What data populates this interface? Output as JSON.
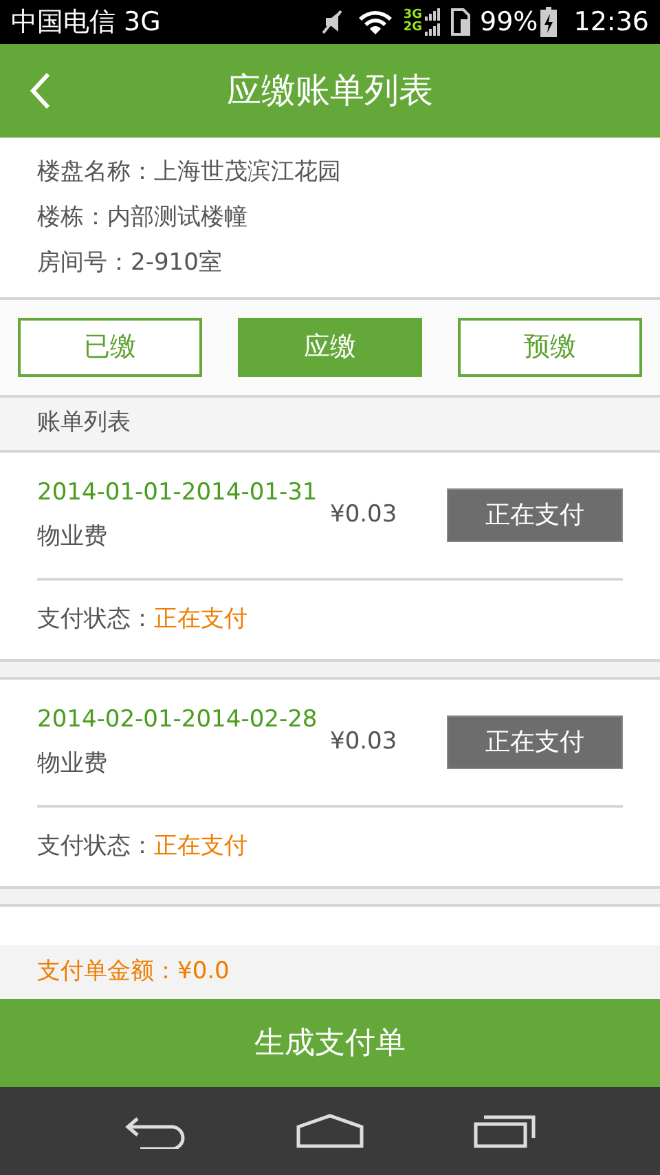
{
  "status_bar": {
    "carrier": "中国电信 3G",
    "network_labels": [
      "3G",
      "2G"
    ],
    "battery": "99%",
    "time": "12:36"
  },
  "header": {
    "title": "应缴账单列表"
  },
  "info": [
    "楼盘名称：上海世茂滨江花园",
    "楼栋：内部测试楼幢",
    "房间号：2-910室"
  ],
  "tabs": [
    {
      "label": "已缴",
      "selected": false
    },
    {
      "label": "应缴",
      "selected": true
    },
    {
      "label": "预缴",
      "selected": false
    }
  ],
  "list_title": "账单列表",
  "bills": [
    {
      "period": "2014-01-01-2014-01-31",
      "item": "物业费",
      "amount": "¥0.03",
      "button": "正在支付",
      "status_label": "支付状态：",
      "status": "正在支付"
    },
    {
      "period": "2014-02-01-2014-02-28",
      "item": "物业费",
      "amount": "¥0.03",
      "button": "正在支付",
      "status_label": "支付状态：",
      "status": "正在支付"
    }
  ],
  "total": "支付单金额：¥0.0",
  "submit": "生成支付单"
}
